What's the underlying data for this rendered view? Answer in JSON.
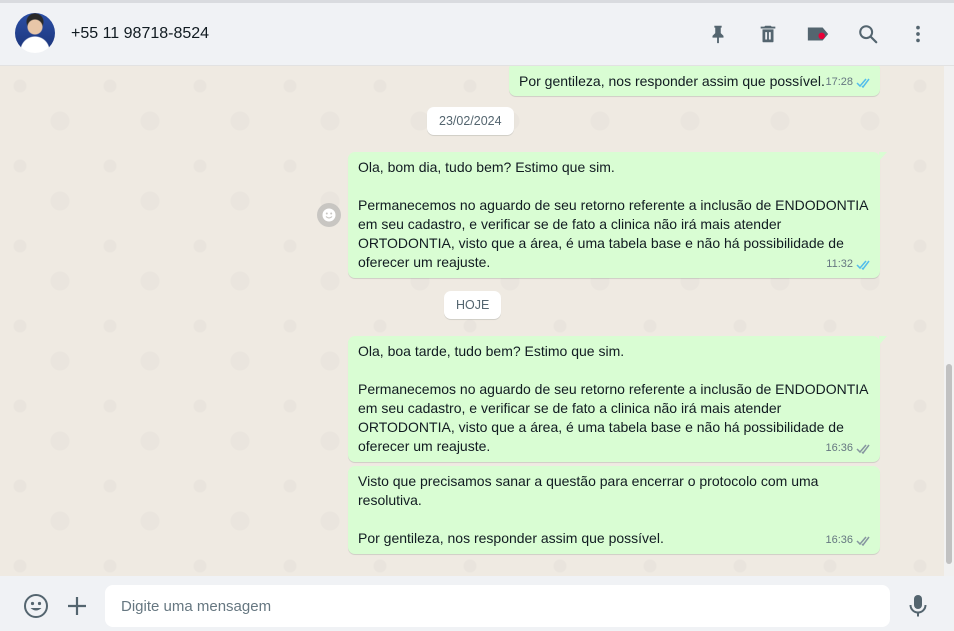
{
  "header": {
    "contact_name": "+55 11 98718-8524",
    "icons": [
      "pin-icon",
      "delete-icon",
      "label-icon",
      "search-icon",
      "menu-icon"
    ]
  },
  "messages": [
    {
      "paragraphs": [
        "Por gentileza, nos responder assim que possível."
      ],
      "time": "17:28",
      "status": "read"
    },
    {
      "paragraphs": [
        "Ola, bom dia, tudo bem? Estimo que sim.",
        "Permanecemos no aguardo de seu retorno referente a inclusão de ENDODONTIA em seu cadastro, e verificar se de fato a clinica não irá mais atender ORTODONTIA, visto que a área, é uma tabela base e não há possibilidade de oferecer um reajuste."
      ],
      "time": "11:32",
      "status": "read"
    },
    {
      "paragraphs": [
        "Ola, boa tarde, tudo bem? Estimo que sim.",
        "Permanecemos no aguardo de seu retorno referente a inclusão de ENDODONTIA em seu cadastro, e verificar se de fato a clinica não irá mais atender ORTODONTIA, visto que a área, é uma tabela base e não há possibilidade de oferecer um reajuste."
      ],
      "time": "16:36",
      "status": "delivered"
    },
    {
      "paragraphs": [
        "Visto que precisamos sanar a questão para encerrar o protocolo com uma resolutiva.",
        "Por gentileza, nos responder assim que possível."
      ],
      "time": "16:36",
      "status": "delivered"
    }
  ],
  "dates": [
    "23/02/2024",
    "HOJE"
  ],
  "composer": {
    "placeholder": "Digite uma mensagem"
  },
  "colors": {
    "outgoing_bubble": "#d9fdd3",
    "read_ticks": "#53bdeb",
    "delivered_ticks": "#8696a0",
    "chat_background": "#efeae2"
  }
}
